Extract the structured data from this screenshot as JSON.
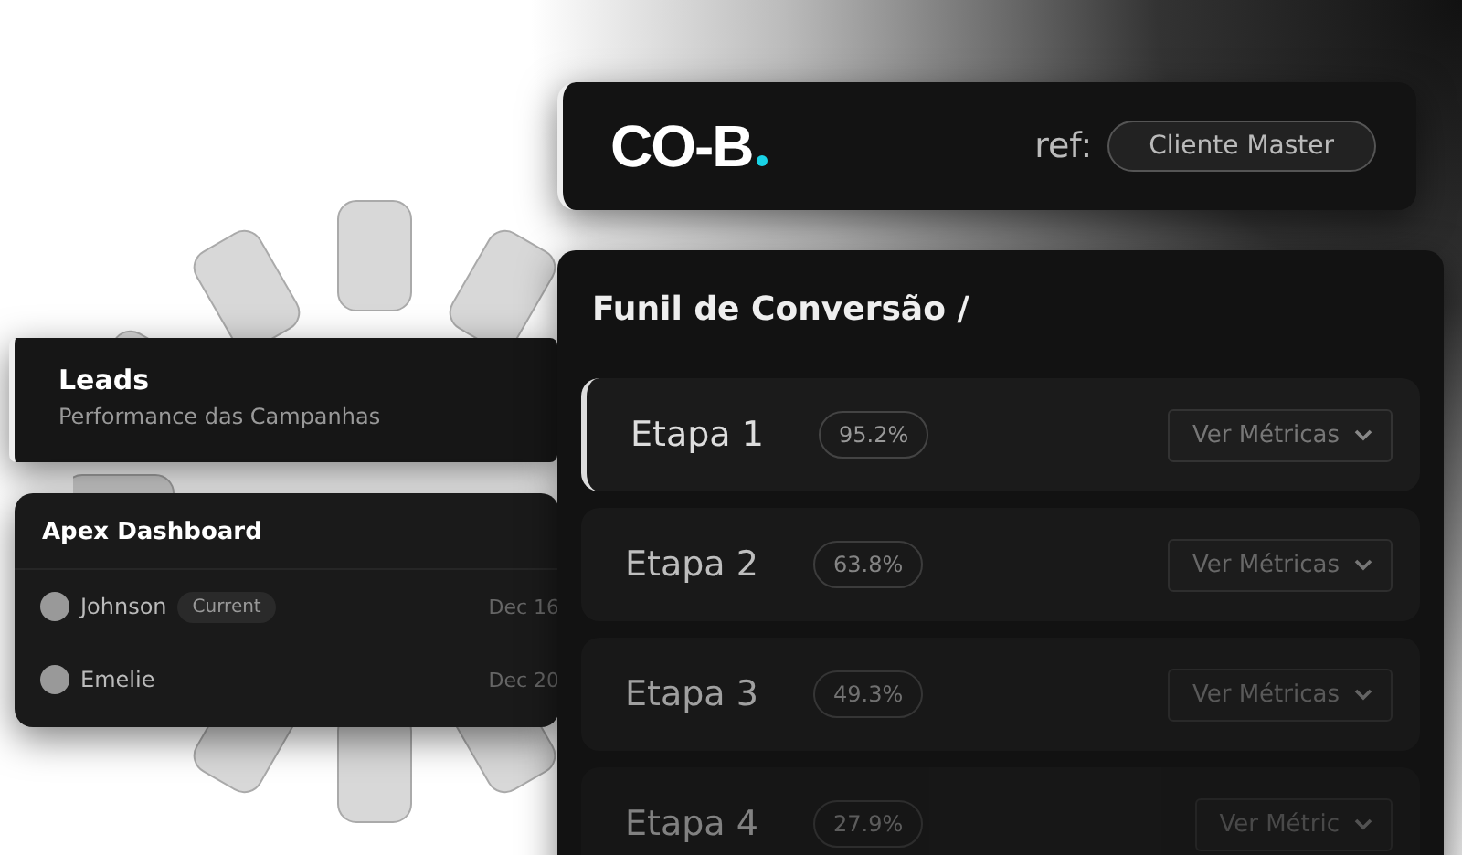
{
  "header": {
    "logo": "CO-B",
    "ref_label": "ref:",
    "ref_value": "Cliente Master"
  },
  "leads_card": {
    "title": "Leads",
    "subtitle": "Performance das Campanhas"
  },
  "dashboard_card": {
    "title": "Apex Dashboard",
    "rows": [
      {
        "name": "Johnson",
        "badge": "Current",
        "date": "Dec 16"
      },
      {
        "name": "Emelie",
        "date": "Dec 20"
      }
    ]
  },
  "funnel": {
    "title": "Funil de Conversão /",
    "stages": [
      {
        "label": "Etapa 1",
        "rate": "95.2%",
        "action": "Ver Métricas",
        "selected": true
      },
      {
        "label": "Etapa 2",
        "rate": "63.8%",
        "action": "Ver Métricas",
        "selected": false
      },
      {
        "label": "Etapa 3",
        "rate": "49.3%",
        "action": "Ver Métricas",
        "selected": false
      },
      {
        "label": "Etapa 4",
        "rate": "27.9%",
        "action": "Ver Métric",
        "selected": false
      }
    ]
  }
}
